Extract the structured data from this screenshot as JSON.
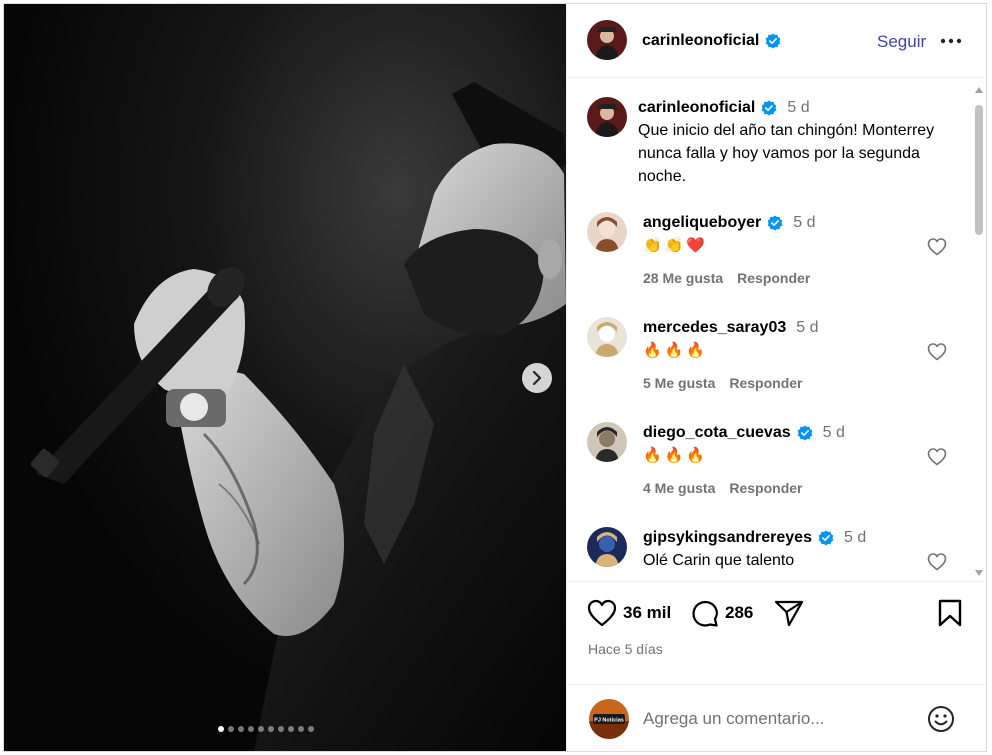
{
  "post": {
    "username": "carinleonoficial",
    "follow_label": "Seguir",
    "caption": {
      "username": "carinleonoficial",
      "time": "5 d",
      "text": "Que inicio del año tan chingón! Monterrey nunca falla y hoy vamos por la segunda noche."
    },
    "carousel": {
      "count": 10,
      "active": 1
    }
  },
  "comments": [
    {
      "username": "angeliqueboyer",
      "verified": true,
      "time": "5 d",
      "text": "👏👏❤️",
      "likes": "28 Me gusta",
      "reply": "Responder"
    },
    {
      "username": "mercedes_saray03",
      "verified": false,
      "time": "5 d",
      "text": "🔥🔥🔥",
      "likes": "5 Me gusta",
      "reply": "Responder"
    },
    {
      "username": "diego_cota_cuevas",
      "verified": true,
      "time": "5 d",
      "text": "🔥🔥🔥",
      "likes": "4 Me gusta",
      "reply": "Responder"
    },
    {
      "username": "gipsykingsandrereyes",
      "verified": true,
      "time": "5 d",
      "text": "Olé Carin que talento",
      "likes": "",
      "reply": ""
    }
  ],
  "actions": {
    "likes_count": "36 mil",
    "comments_count": "286",
    "posted_ago": "Hace 5 días"
  },
  "add_comment": {
    "placeholder": "Agrega un comentario...",
    "avatar_text": "PJ Noticias"
  },
  "colors": {
    "accent": "#3d44ad",
    "verified": "#0095f6",
    "secondary_text": "#737373",
    "divider": "#efefef"
  }
}
